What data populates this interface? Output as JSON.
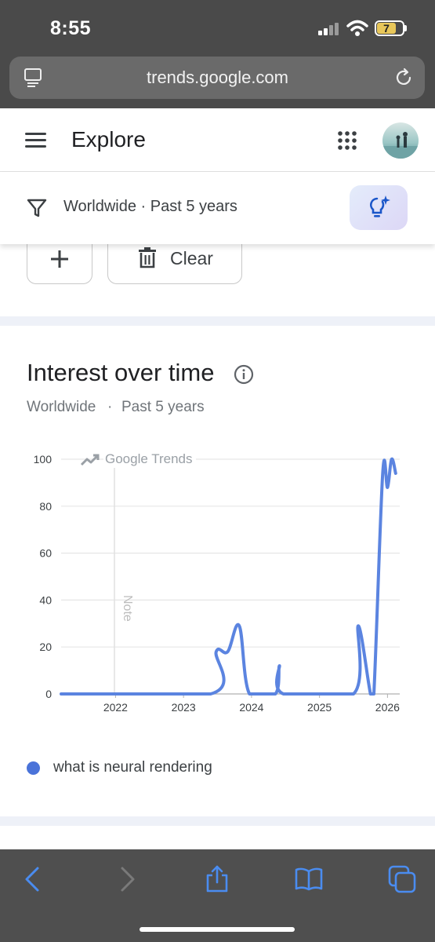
{
  "status": {
    "time": "8:55",
    "battery": "7"
  },
  "browser": {
    "url": "trends.google.com"
  },
  "header": {
    "title": "Explore"
  },
  "filter": {
    "summary": "Worldwide · Past 5 years"
  },
  "terms": {
    "clear_label": "Clear"
  },
  "interest": {
    "title": "Interest over time",
    "region": "Worldwide",
    "separator": "·",
    "period": "Past 5 years",
    "watermark": "Google Trends",
    "note_label": "Note"
  },
  "chart_data": {
    "type": "line",
    "ylim": [
      0,
      100
    ],
    "yticks": [
      "0",
      "20",
      "40",
      "60",
      "80",
      "100"
    ],
    "xticks": [
      "2022",
      "2023",
      "2024",
      "2025",
      "2026"
    ],
    "grid": true,
    "series": [
      {
        "name": "what is neural rendering",
        "color": "#5b84e0",
        "x": [
          2021.2,
          2023.4,
          2023.48,
          2023.65,
          2023.82,
          2023.97,
          2024.35,
          2024.41,
          2024.47,
          2025.5,
          2025.57,
          2025.75,
          2025.8,
          2025.93,
          2026.0,
          2026.06,
          2026.12
        ],
        "values": [
          0,
          0,
          18,
          18,
          29,
          0,
          0,
          12,
          0,
          0,
          29,
          0,
          0,
          94,
          88,
          100,
          94
        ]
      }
    ]
  },
  "legend": {
    "label": "what is neural rendering"
  },
  "colors": {
    "accent": "#4a73d9",
    "line": "#5b84e0",
    "toolbar": "#4f4f4f"
  }
}
